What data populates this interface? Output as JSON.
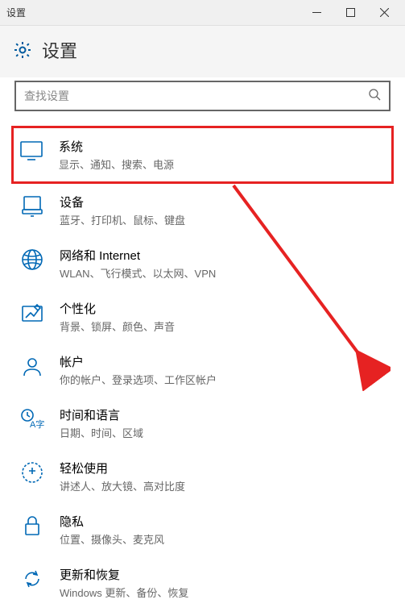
{
  "titlebar": {
    "title": "设置"
  },
  "header": {
    "title": "设置",
    "icon": "gear-icon"
  },
  "search": {
    "placeholder": "查找设置"
  },
  "items": [
    {
      "icon": "display-icon",
      "title": "系统",
      "desc": "显示、通知、搜索、电源",
      "highlighted": true
    },
    {
      "icon": "devices-icon",
      "title": "设备",
      "desc": "蓝牙、打印机、鼠标、键盘",
      "highlighted": false
    },
    {
      "icon": "network-icon",
      "title": "网络和 Internet",
      "desc": "WLAN、飞行模式、以太网、VPN",
      "highlighted": false
    },
    {
      "icon": "personalization-icon",
      "title": "个性化",
      "desc": "背景、锁屏、颜色、声音",
      "highlighted": false
    },
    {
      "icon": "accounts-icon",
      "title": "帐户",
      "desc": "你的帐户、登录选项、工作区帐户",
      "highlighted": false
    },
    {
      "icon": "time-language-icon",
      "title": "时间和语言",
      "desc": "日期、时间、区域",
      "highlighted": false
    },
    {
      "icon": "ease-of-access-icon",
      "title": "轻松使用",
      "desc": "讲述人、放大镜、高对比度",
      "highlighted": false
    },
    {
      "icon": "privacy-icon",
      "title": "隐私",
      "desc": "位置、摄像头、麦克风",
      "highlighted": false
    },
    {
      "icon": "update-icon",
      "title": "更新和恢复",
      "desc": "Windows 更新、备份、恢复",
      "highlighted": false
    }
  ]
}
